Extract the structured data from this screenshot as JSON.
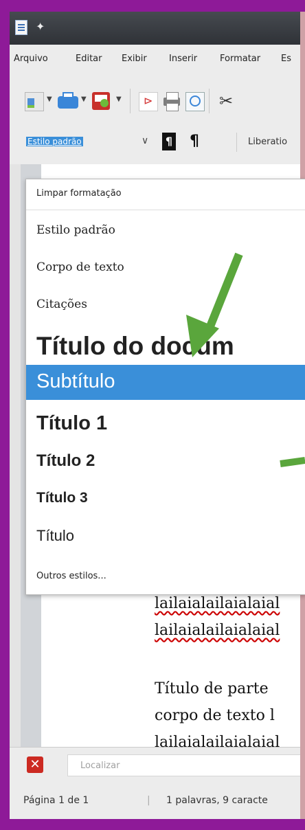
{
  "menubar": {
    "items": [
      "Arquivo",
      "Editar",
      "Exibir",
      "Inserir",
      "Formatar",
      "Es"
    ]
  },
  "toolbar": {
    "style_value": "Estilo padrão",
    "font_value": "Liberatio"
  },
  "styles_dropdown": {
    "items": [
      {
        "label": "Limpar formatação"
      },
      {
        "label": "Estilo padrão"
      },
      {
        "label": "Corpo de texto"
      },
      {
        "label": "Citações"
      },
      {
        "label": "Título do docum"
      },
      {
        "label": "Subtítulo",
        "selected": true
      },
      {
        "label": "Título 1"
      },
      {
        "label": "Título 2"
      },
      {
        "label": "Título 3"
      },
      {
        "label": "Título"
      },
      {
        "label": "Outros estilos..."
      }
    ]
  },
  "document": {
    "lines": [
      "lailaialailaialaial",
      "lailaialailaialaial",
      "Título de parte",
      "corpo de texto  l",
      "lailaialailaialaial"
    ]
  },
  "findbar": {
    "placeholder": "Localizar"
  },
  "statusbar": {
    "page": "Página 1 de 1",
    "words": "1 palavras, 9 caracte"
  },
  "colors": {
    "background": "#8e1a98",
    "selection": "#3a8fd9",
    "arrow": "#5aa63c"
  }
}
